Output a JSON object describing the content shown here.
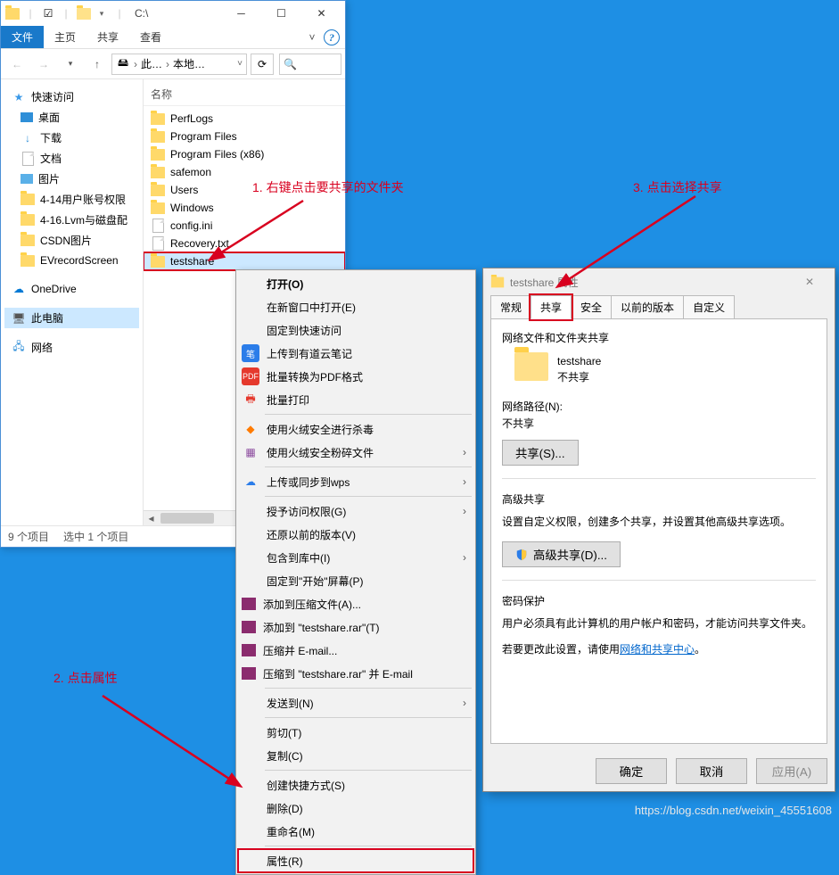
{
  "explorer": {
    "title": "C:\\",
    "tabs": {
      "file": "文件",
      "home": "主页",
      "share": "共享",
      "view": "查看"
    },
    "address": {
      "c1": "此…",
      "c2": "本地…"
    },
    "nav": {
      "quick": "快速访问",
      "items": [
        "桌面",
        "下载",
        "文档",
        "图片",
        "4-14用户账号权限",
        "4-16.Lvm与磁盘配",
        "CSDN图片",
        "EVrecordScreen"
      ],
      "onedrive": "OneDrive",
      "thispc": "此电脑",
      "network": "网络"
    },
    "list": {
      "header": "名称",
      "rows": [
        "PerfLogs",
        "Program Files",
        "Program Files (x86)",
        "safemon",
        "Users",
        "Windows",
        "config.ini",
        "Recovery.txt",
        "testshare"
      ]
    },
    "status": {
      "count": "9 个项目",
      "selected": "选中 1 个项目"
    }
  },
  "context_menu": {
    "open": "打开(O)",
    "new_window": "在新窗口中打开(E)",
    "pin_quick": "固定到快速访问",
    "youdao": "上传到有道云笔记",
    "pdf": "批量转换为PDF格式",
    "print": "批量打印",
    "huorong_scan": "使用火绒安全进行杀毒",
    "huorong_shred": "使用火绒安全粉碎文件",
    "wps_sync": "上传或同步到wps",
    "grant_access": "授予访问权限(G)",
    "restore": "还原以前的版本(V)",
    "include_lib": "包含到库中(I)",
    "pin_start": "固定到\"开始\"屏幕(P)",
    "add_archive": "添加到压缩文件(A)...",
    "add_rar": "添加到 \"testshare.rar\"(T)",
    "compress_email": "压缩并 E-mail...",
    "compress_rar_email": "压缩到 \"testshare.rar\" 并 E-mail",
    "send_to": "发送到(N)",
    "cut": "剪切(T)",
    "copy": "复制(C)",
    "shortcut": "创建快捷方式(S)",
    "delete": "删除(D)",
    "rename": "重命名(M)",
    "properties": "属性(R)"
  },
  "properties": {
    "title": "testshare 属性",
    "tabs": {
      "general": "常规",
      "share": "共享",
      "security": "安全",
      "previous": "以前的版本",
      "custom": "自定义"
    },
    "section1": "网络文件和文件夹共享",
    "folder_name": "testshare",
    "share_state": "不共享",
    "path_label": "网络路径(N):",
    "path_value": "不共享",
    "share_btn": "共享(S)...",
    "adv_title": "高级共享",
    "adv_desc": "设置自定义权限，创建多个共享，并设置其他高级共享选项。",
    "adv_btn": "高级共享(D)...",
    "pwd_title": "密码保护",
    "pwd_desc": "用户必须具有此计算机的用户帐户和密码，才能访问共享文件夹。",
    "pwd_hint_prefix": "若要更改此设置，请使用",
    "pwd_link": "网络和共享中心",
    "pwd_hint_suffix": "。",
    "ok": "确定",
    "cancel": "取消",
    "apply": "应用(A)"
  },
  "annotations": {
    "a1": "1. 右键点击要共享的文件夹",
    "a2": "2. 点击属性",
    "a3": "3. 点击选择共享"
  },
  "watermark": "https://blog.csdn.net/weixin_45551608"
}
